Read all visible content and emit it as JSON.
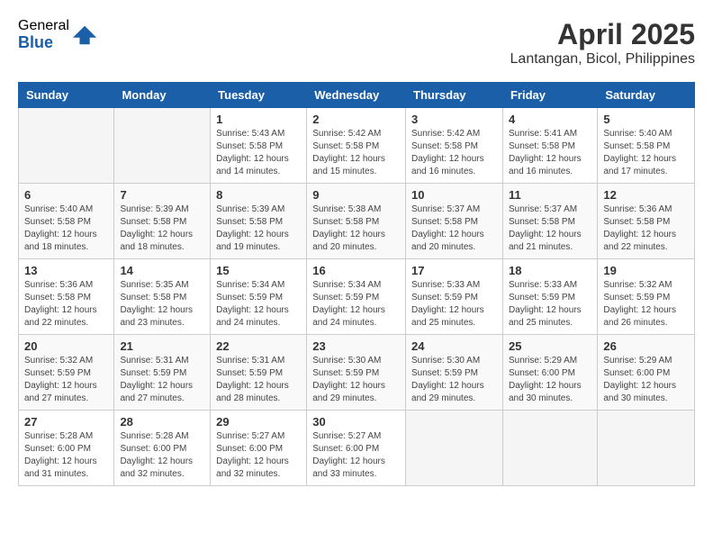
{
  "logo": {
    "general": "General",
    "blue": "Blue"
  },
  "title": {
    "month": "April 2025",
    "location": "Lantangan, Bicol, Philippines"
  },
  "weekdays": [
    "Sunday",
    "Monday",
    "Tuesday",
    "Wednesday",
    "Thursday",
    "Friday",
    "Saturday"
  ],
  "weeks": [
    [
      null,
      null,
      {
        "day": 1,
        "sunrise": "5:43 AM",
        "sunset": "5:58 PM",
        "daylight": "12 hours and 14 minutes."
      },
      {
        "day": 2,
        "sunrise": "5:42 AM",
        "sunset": "5:58 PM",
        "daylight": "12 hours and 15 minutes."
      },
      {
        "day": 3,
        "sunrise": "5:42 AM",
        "sunset": "5:58 PM",
        "daylight": "12 hours and 16 minutes."
      },
      {
        "day": 4,
        "sunrise": "5:41 AM",
        "sunset": "5:58 PM",
        "daylight": "12 hours and 16 minutes."
      },
      {
        "day": 5,
        "sunrise": "5:40 AM",
        "sunset": "5:58 PM",
        "daylight": "12 hours and 17 minutes."
      }
    ],
    [
      {
        "day": 6,
        "sunrise": "5:40 AM",
        "sunset": "5:58 PM",
        "daylight": "12 hours and 18 minutes."
      },
      {
        "day": 7,
        "sunrise": "5:39 AM",
        "sunset": "5:58 PM",
        "daylight": "12 hours and 18 minutes."
      },
      {
        "day": 8,
        "sunrise": "5:39 AM",
        "sunset": "5:58 PM",
        "daylight": "12 hours and 19 minutes."
      },
      {
        "day": 9,
        "sunrise": "5:38 AM",
        "sunset": "5:58 PM",
        "daylight": "12 hours and 20 minutes."
      },
      {
        "day": 10,
        "sunrise": "5:37 AM",
        "sunset": "5:58 PM",
        "daylight": "12 hours and 20 minutes."
      },
      {
        "day": 11,
        "sunrise": "5:37 AM",
        "sunset": "5:58 PM",
        "daylight": "12 hours and 21 minutes."
      },
      {
        "day": 12,
        "sunrise": "5:36 AM",
        "sunset": "5:58 PM",
        "daylight": "12 hours and 22 minutes."
      }
    ],
    [
      {
        "day": 13,
        "sunrise": "5:36 AM",
        "sunset": "5:58 PM",
        "daylight": "12 hours and 22 minutes."
      },
      {
        "day": 14,
        "sunrise": "5:35 AM",
        "sunset": "5:58 PM",
        "daylight": "12 hours and 23 minutes."
      },
      {
        "day": 15,
        "sunrise": "5:34 AM",
        "sunset": "5:59 PM",
        "daylight": "12 hours and 24 minutes."
      },
      {
        "day": 16,
        "sunrise": "5:34 AM",
        "sunset": "5:59 PM",
        "daylight": "12 hours and 24 minutes."
      },
      {
        "day": 17,
        "sunrise": "5:33 AM",
        "sunset": "5:59 PM",
        "daylight": "12 hours and 25 minutes."
      },
      {
        "day": 18,
        "sunrise": "5:33 AM",
        "sunset": "5:59 PM",
        "daylight": "12 hours and 25 minutes."
      },
      {
        "day": 19,
        "sunrise": "5:32 AM",
        "sunset": "5:59 PM",
        "daylight": "12 hours and 26 minutes."
      }
    ],
    [
      {
        "day": 20,
        "sunrise": "5:32 AM",
        "sunset": "5:59 PM",
        "daylight": "12 hours and 27 minutes."
      },
      {
        "day": 21,
        "sunrise": "5:31 AM",
        "sunset": "5:59 PM",
        "daylight": "12 hours and 27 minutes."
      },
      {
        "day": 22,
        "sunrise": "5:31 AM",
        "sunset": "5:59 PM",
        "daylight": "12 hours and 28 minutes."
      },
      {
        "day": 23,
        "sunrise": "5:30 AM",
        "sunset": "5:59 PM",
        "daylight": "12 hours and 29 minutes."
      },
      {
        "day": 24,
        "sunrise": "5:30 AM",
        "sunset": "5:59 PM",
        "daylight": "12 hours and 29 minutes."
      },
      {
        "day": 25,
        "sunrise": "5:29 AM",
        "sunset": "6:00 PM",
        "daylight": "12 hours and 30 minutes."
      },
      {
        "day": 26,
        "sunrise": "5:29 AM",
        "sunset": "6:00 PM",
        "daylight": "12 hours and 30 minutes."
      }
    ],
    [
      {
        "day": 27,
        "sunrise": "5:28 AM",
        "sunset": "6:00 PM",
        "daylight": "12 hours and 31 minutes."
      },
      {
        "day": 28,
        "sunrise": "5:28 AM",
        "sunset": "6:00 PM",
        "daylight": "12 hours and 32 minutes."
      },
      {
        "day": 29,
        "sunrise": "5:27 AM",
        "sunset": "6:00 PM",
        "daylight": "12 hours and 32 minutes."
      },
      {
        "day": 30,
        "sunrise": "5:27 AM",
        "sunset": "6:00 PM",
        "daylight": "12 hours and 33 minutes."
      },
      null,
      null,
      null
    ]
  ],
  "labels": {
    "sunrise": "Sunrise:",
    "sunset": "Sunset:",
    "daylight": "Daylight:"
  }
}
